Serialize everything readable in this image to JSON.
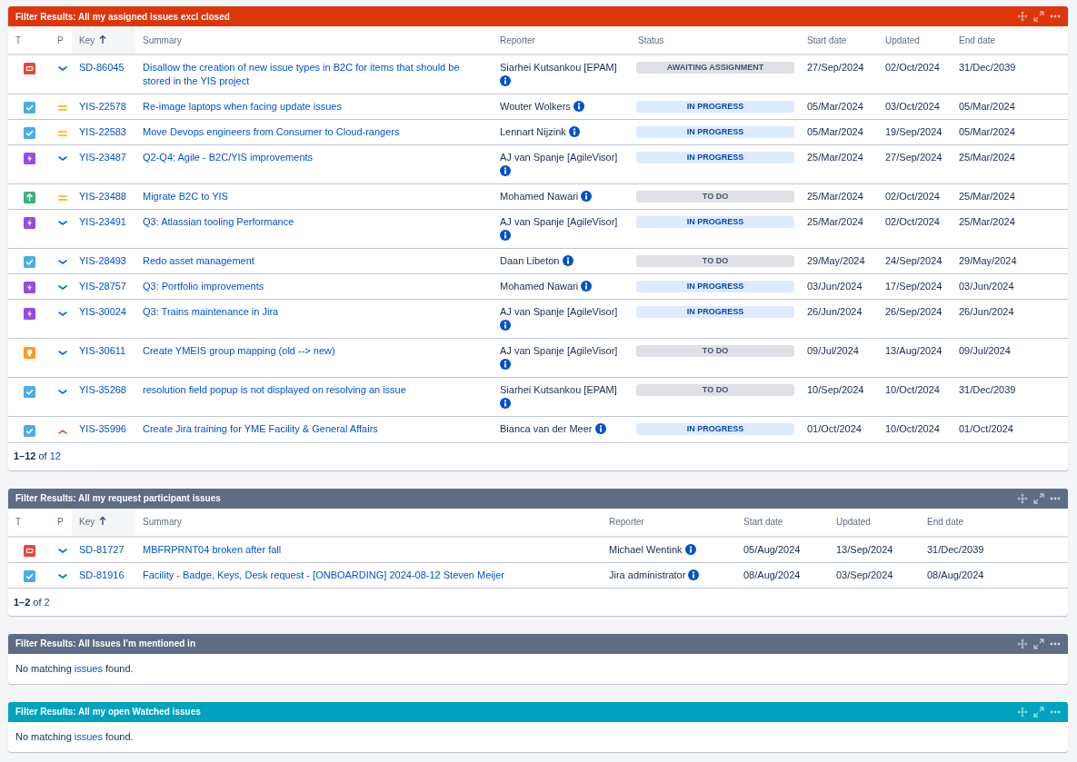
{
  "gadgets": [
    {
      "title": "Filter Results: All my assigned issues excl closed",
      "color": "#de350b",
      "columns": [
        {
          "label": "T",
          "kind": "type",
          "sorted": false
        },
        {
          "label": "P",
          "kind": "priority",
          "sorted": false
        },
        {
          "label": "Key",
          "kind": "key",
          "sorted": true
        },
        {
          "label": "Summary",
          "kind": "summary",
          "sorted": false
        },
        {
          "label": "Reporter",
          "kind": "reporter",
          "sorted": false
        },
        {
          "label": "Status",
          "kind": "status",
          "sorted": false
        },
        {
          "label": "Start date",
          "kind": "start_date",
          "sorted": false
        },
        {
          "label": "Updated",
          "kind": "updated",
          "sorted": false
        },
        {
          "label": "End date",
          "kind": "end_date",
          "sorted": false
        }
      ],
      "rows": [
        {
          "type": {
            "kind": "service-request"
          },
          "priority": {
            "kind": "low"
          },
          "key": "SD-86045",
          "summary": "Disallow the creation of new issue types in B2C for items that should be stored in the YIS project",
          "reporter": "Siarhei Kutsankou [EPAM]",
          "status": {
            "label": "AWAITING ASSIGNMENT",
            "kind": "todo"
          },
          "start_date": "27/Sep/2024",
          "updated": "02/Oct/2024",
          "end_date": "31/Dec/2039"
        },
        {
          "type": {
            "kind": "task"
          },
          "priority": {
            "kind": "medium"
          },
          "key": "YIS-22578",
          "summary": "Re-image laptops when facing update issues",
          "reporter": "Wouter Wolkers",
          "status": {
            "label": "IN PROGRESS",
            "kind": "inprogress"
          },
          "start_date": "05/Mar/2024",
          "updated": "03/Oct/2024",
          "end_date": "05/Mar/2024"
        },
        {
          "type": {
            "kind": "task"
          },
          "priority": {
            "kind": "medium"
          },
          "key": "YIS-22583",
          "summary": "Move Devops engineers from Consumer to Cloud-rangers",
          "reporter": "Lennart Nijzink",
          "status": {
            "label": "IN PROGRESS",
            "kind": "inprogress"
          },
          "start_date": "05/Mar/2024",
          "updated": "19/Sep/2024",
          "end_date": "05/Mar/2024"
        },
        {
          "type": {
            "kind": "epic"
          },
          "priority": {
            "kind": "low"
          },
          "key": "YIS-23487",
          "summary": "Q2-Q4: Agile - B2C/YIS improvements",
          "reporter": "AJ van Spanje [AgileVisor]",
          "status": {
            "label": "IN PROGRESS",
            "kind": "inprogress"
          },
          "start_date": "25/Mar/2024",
          "updated": "27/Sep/2024",
          "end_date": "25/Mar/2024"
        },
        {
          "type": {
            "kind": "improvement"
          },
          "priority": {
            "kind": "medium"
          },
          "key": "YIS-23488",
          "summary": "Migrate B2C to YIS",
          "reporter": "Mohamed Nawari",
          "status": {
            "label": "TO DO",
            "kind": "todo"
          },
          "start_date": "25/Mar/2024",
          "updated": "02/Oct/2024",
          "end_date": "25/Mar/2024"
        },
        {
          "type": {
            "kind": "epic"
          },
          "priority": {
            "kind": "low"
          },
          "key": "YIS-23491",
          "summary": "Q3: Atlassian tooling Performance",
          "reporter": "AJ van Spanje [AgileVisor]",
          "status": {
            "label": "IN PROGRESS",
            "kind": "inprogress"
          },
          "start_date": "25/Mar/2024",
          "updated": "02/Oct/2024",
          "end_date": "25/Mar/2024"
        },
        {
          "type": {
            "kind": "task"
          },
          "priority": {
            "kind": "low"
          },
          "key": "YIS-28493",
          "summary": "Redo asset management",
          "reporter": "Daan Libeton",
          "status": {
            "label": "TO DO",
            "kind": "todo"
          },
          "start_date": "29/May/2024",
          "updated": "24/Sep/2024",
          "end_date": "29/May/2024"
        },
        {
          "type": {
            "kind": "epic"
          },
          "priority": {
            "kind": "low"
          },
          "key": "YIS-28757",
          "summary": "Q3: Portfolio improvements",
          "reporter": "Mohamed Nawari",
          "status": {
            "label": "IN PROGRESS",
            "kind": "inprogress"
          },
          "start_date": "03/Jun/2024",
          "updated": "17/Sep/2024",
          "end_date": "03/Jun/2024"
        },
        {
          "type": {
            "kind": "epic"
          },
          "priority": {
            "kind": "low"
          },
          "key": "YIS-30024",
          "summary": "Q3: Trains maintenance in Jira",
          "reporter": "AJ van Spanje [AgileVisor]",
          "status": {
            "label": "IN PROGRESS",
            "kind": "inprogress"
          },
          "start_date": "26/Jun/2024",
          "updated": "26/Sep/2024",
          "end_date": "26/Jun/2024"
        },
        {
          "type": {
            "kind": "idea"
          },
          "priority": {
            "kind": "low"
          },
          "key": "YIS-30611",
          "summary": "Create YMEIS group mapping (old --> new)",
          "reporter": "AJ van Spanje [AgileVisor]",
          "status": {
            "label": "TO DO",
            "kind": "todo"
          },
          "start_date": "09/Jul/2024",
          "updated": "13/Aug/2024",
          "end_date": "09/Jul/2024"
        },
        {
          "type": {
            "kind": "task"
          },
          "priority": {
            "kind": "low"
          },
          "key": "YIS-35268",
          "summary": "resolution field popup is not displayed on resolving an issue",
          "reporter": "Siarhei Kutsankou [EPAM]",
          "status": {
            "label": "TO DO",
            "kind": "todo"
          },
          "start_date": "10/Sep/2024",
          "updated": "10/Oct/2024",
          "end_date": "31/Dec/2039"
        },
        {
          "type": {
            "kind": "task"
          },
          "priority": {
            "kind": "high"
          },
          "key": "YIS-35996",
          "summary": "Create Jira training for YME Facility & General Affairs",
          "reporter": "Bianca van der Meer",
          "status": {
            "label": "IN PROGRESS",
            "kind": "inprogress"
          },
          "start_date": "01/Oct/2024",
          "updated": "10/Oct/2024",
          "end_date": "01/Oct/2024"
        }
      ],
      "pagination": {
        "range": "1–12",
        "of": "of",
        "total": "12"
      }
    },
    {
      "title": "Filter Results: All my request participant issues",
      "color": "#5e6c84",
      "columns": [
        {
          "label": "T",
          "kind": "type",
          "sorted": false
        },
        {
          "label": "P",
          "kind": "priority",
          "sorted": false
        },
        {
          "label": "Key",
          "kind": "key",
          "sorted": true
        },
        {
          "label": "Summary",
          "kind": "summary",
          "sorted": false
        },
        {
          "label": "Reporter",
          "kind": "reporter",
          "sorted": false
        },
        {
          "label": "Start date",
          "kind": "start_date",
          "sorted": false
        },
        {
          "label": "Updated",
          "kind": "updated",
          "sorted": false
        },
        {
          "label": "End date",
          "kind": "end_date",
          "sorted": false
        }
      ],
      "rows": [
        {
          "type": {
            "kind": "service-request"
          },
          "priority": {
            "kind": "low"
          },
          "key": "SD-81727",
          "summary": "MBFRPRNT04 broken after fall",
          "reporter": "Michael Wentink",
          "start_date": "05/Aug/2024",
          "updated": "13/Sep/2024",
          "end_date": "31/Dec/2039"
        },
        {
          "type": {
            "kind": "task"
          },
          "priority": {
            "kind": "low"
          },
          "key": "SD-81916",
          "summary": "Facility - Badge, Keys, Desk request - [ONBOARDING] 2024-08-12 Steven Meijer",
          "reporter": "Jira administrator",
          "start_date": "08/Aug/2024",
          "updated": "03/Sep/2024",
          "end_date": "08/Aug/2024"
        }
      ],
      "pagination": {
        "range": "1–2",
        "of": "of",
        "total": "2"
      }
    },
    {
      "title": "Filter Results: All Issues I’m mentioned in",
      "color": "#5e6c84",
      "empty": {
        "before": "No matching",
        "link": "issues",
        "after": "found."
      }
    },
    {
      "title": "Filter Results: All my open Watched issues",
      "color": "#00a3bf",
      "empty": {
        "before": "No matching",
        "link": "issues",
        "after": "found."
      }
    }
  ]
}
